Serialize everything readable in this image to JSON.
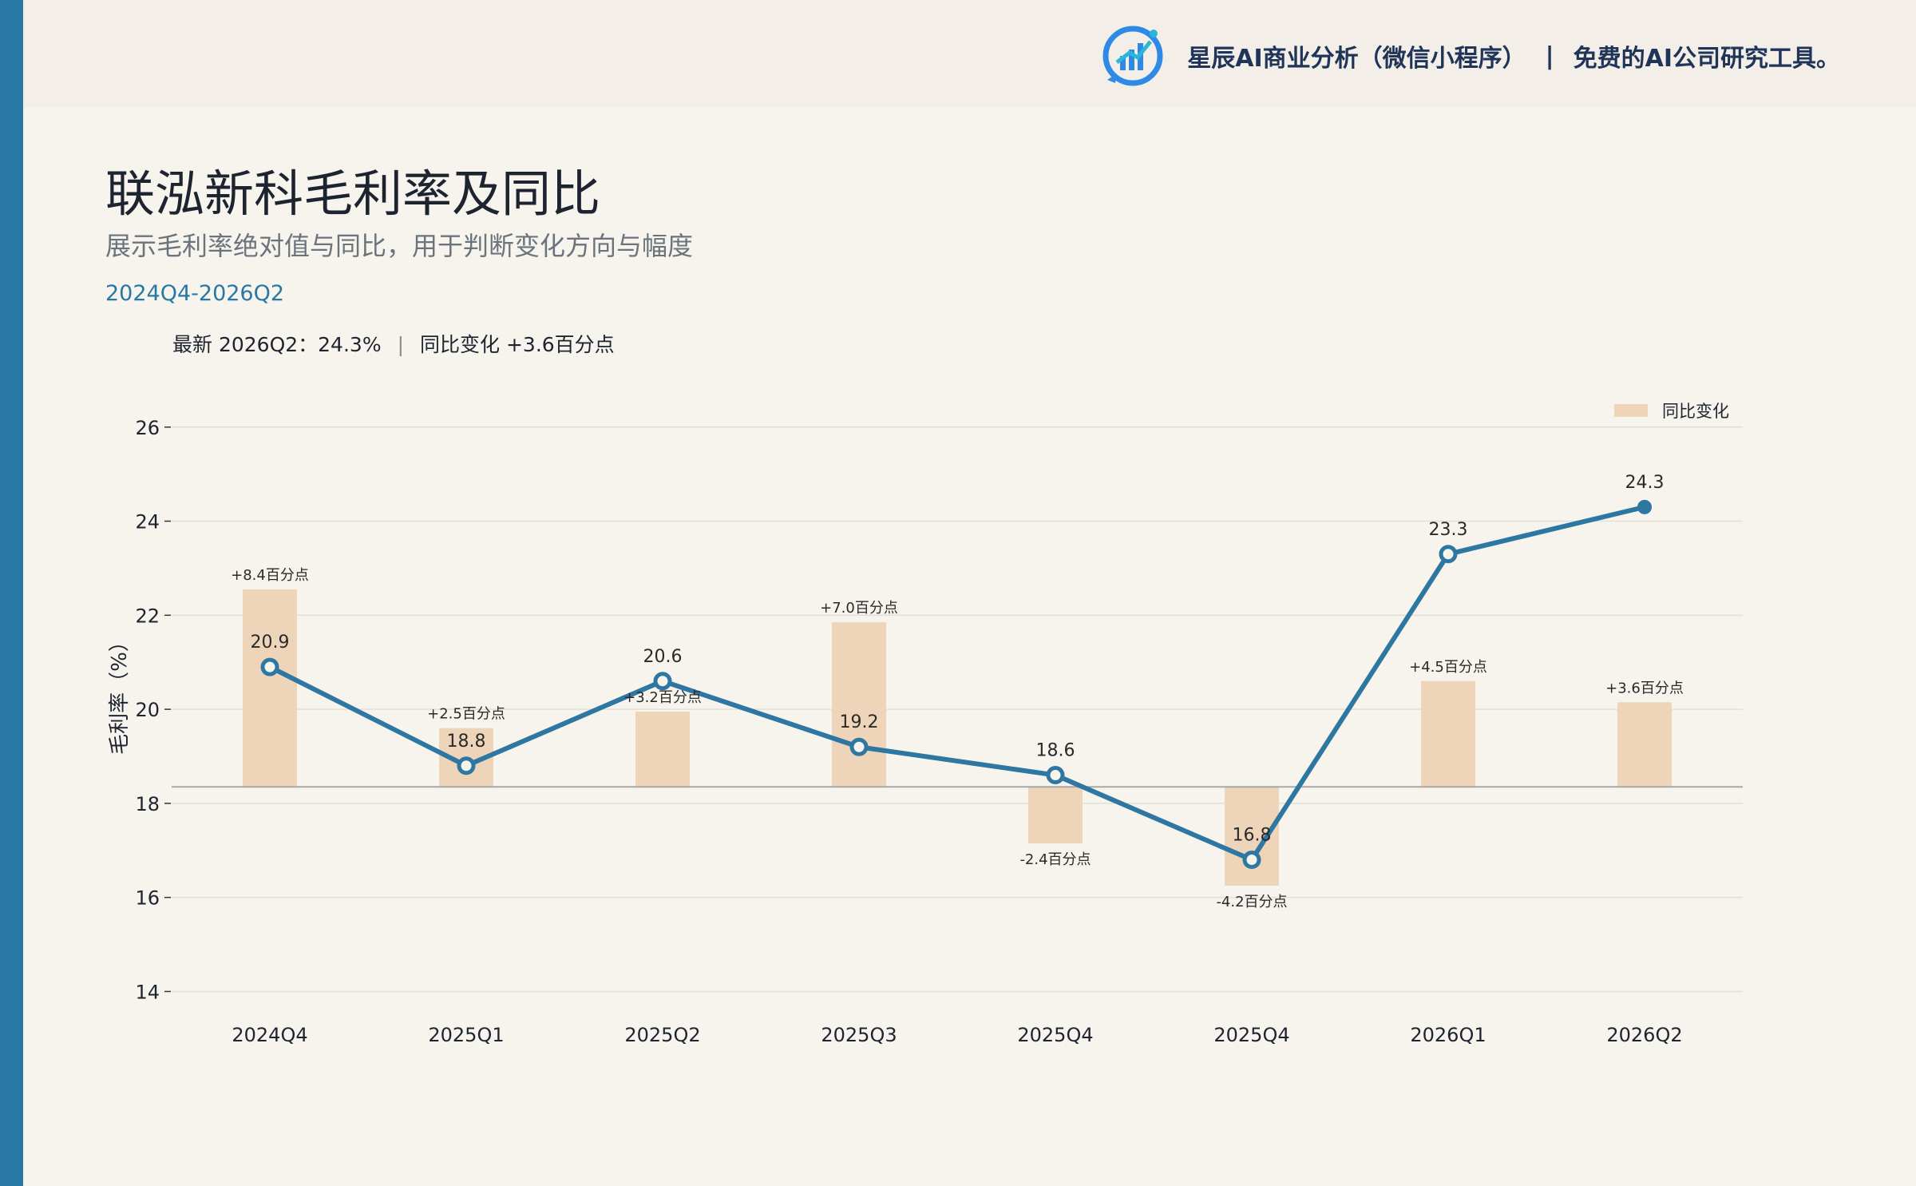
{
  "header": {
    "brand_name": "星辰AI商业分析（微信小程序）",
    "brand_separator": "|",
    "brand_tagline": "免费的AI公司研究工具。"
  },
  "title": "联泓新科毛利率及同比",
  "subtitle": "展示毛利率绝对值与同比，用于判断变化方向与幅度",
  "date_range": "2024Q4-2026Q2",
  "summary": {
    "latest": "最新 2026Q2：24.3%",
    "separator": "|",
    "yoy": "同比变化 +3.6百分点"
  },
  "colors": {
    "accent": "#2878a6",
    "line": "#2e77a2",
    "bar": "#eed5b9",
    "background": "#f7f4ee"
  },
  "chart_data": {
    "type": "bar+line",
    "categories": [
      "2024Q4",
      "2025Q1",
      "2025Q2",
      "2025Q3",
      "2025Q4",
      "2025Q4",
      "2026Q1",
      "2026Q2"
    ],
    "ylabel": "毛利率（%）",
    "ylim": [
      13.6,
      27.1
    ],
    "yticks": [
      14,
      16,
      18,
      20,
      22,
      24,
      26
    ],
    "grid": true,
    "legend": {
      "position": "top-right",
      "label": "同比变化"
    },
    "bar_baseline": 18.35,
    "line_series": {
      "values": [
        20.9,
        18.8,
        20.6,
        19.2,
        18.6,
        16.8,
        23.3,
        24.3
      ],
      "labels": [
        "20.9",
        "18.8",
        "20.6",
        "19.2",
        "18.6",
        "16.8",
        "23.3",
        "24.3"
      ]
    },
    "bar_series": {
      "name": "同比变化",
      "values": [
        8.4,
        2.5,
        3.2,
        7.0,
        -2.4,
        -4.2,
        4.5,
        3.6
      ],
      "labels": [
        "+8.4百分点",
        "+2.5百分点",
        "+3.2百分点",
        "+7.0百分点",
        "-2.4百分点",
        "-4.2百分点",
        "+4.5百分点",
        "+3.6百分点"
      ]
    }
  }
}
